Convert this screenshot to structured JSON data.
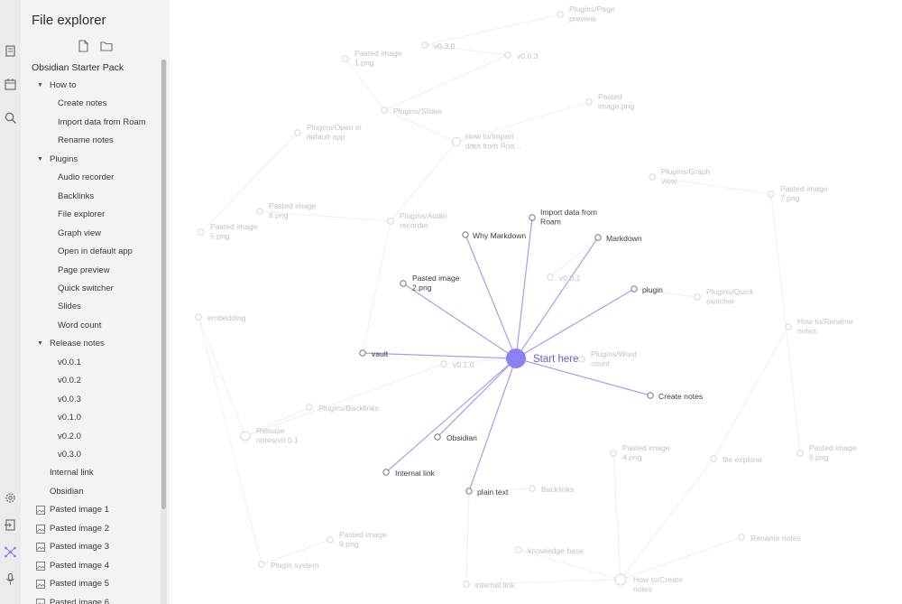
{
  "explorer": {
    "title": "File explorer",
    "vault_name": "Obsidian Starter Pack",
    "tree": [
      {
        "label": "How to",
        "type": "folder"
      },
      {
        "label": "Create notes",
        "type": "file"
      },
      {
        "label": "Import data from Roam",
        "type": "file"
      },
      {
        "label": "Rename notes",
        "type": "file"
      },
      {
        "label": "Plugins",
        "type": "folder"
      },
      {
        "label": "Audio recorder",
        "type": "file"
      },
      {
        "label": "Backlinks",
        "type": "file"
      },
      {
        "label": "File explorer",
        "type": "file"
      },
      {
        "label": "Graph view",
        "type": "file"
      },
      {
        "label": "Open in default app",
        "type": "file"
      },
      {
        "label": "Page preview",
        "type": "file"
      },
      {
        "label": "Quick switcher",
        "type": "file"
      },
      {
        "label": "Slides",
        "type": "file"
      },
      {
        "label": "Word count",
        "type": "file"
      },
      {
        "label": "Release notes",
        "type": "folder"
      },
      {
        "label": "v0.0.1",
        "type": "file"
      },
      {
        "label": "v0.0.2",
        "type": "file"
      },
      {
        "label": "v0.0.3",
        "type": "file"
      },
      {
        "label": "v0.1.0",
        "type": "file"
      },
      {
        "label": "v0.2.0",
        "type": "file"
      },
      {
        "label": "v0.3.0",
        "type": "file"
      },
      {
        "label": "Internal link",
        "type": "root-file"
      },
      {
        "label": "Obsidian",
        "type": "root-file"
      },
      {
        "label": "Pasted image 1",
        "type": "image"
      },
      {
        "label": "Pasted image 2",
        "type": "image"
      },
      {
        "label": "Pasted image 3",
        "type": "image"
      },
      {
        "label": "Pasted image 4",
        "type": "image"
      },
      {
        "label": "Pasted image 5",
        "type": "image"
      },
      {
        "label": "Pasted image 6",
        "type": "image"
      }
    ]
  },
  "ribbon": {
    "icons": [
      "files-icon",
      "calendar-icon",
      "search-icon",
      "settings-icon",
      "import-icon",
      "graph-icon",
      "microphone-icon"
    ]
  },
  "graph": {
    "center": {
      "id": "start",
      "label": "Start here"
    },
    "nodes": [
      {
        "id": "start",
        "label": "Start here"
      },
      {
        "id": "why_markdown",
        "label": "Why Markdown"
      },
      {
        "id": "import_roam",
        "label": "Import data from Roam"
      },
      {
        "id": "markdown",
        "label": "Markdown"
      },
      {
        "id": "plugin",
        "label": "plugin"
      },
      {
        "id": "pasted2",
        "label": "Pasted image 2.png"
      },
      {
        "id": "vault",
        "label": "vault"
      },
      {
        "id": "create_notes",
        "label": "Create notes"
      },
      {
        "id": "obsidian",
        "label": "Obsidian"
      },
      {
        "id": "internal_link_c",
        "label": "Internal link"
      },
      {
        "id": "plain_text",
        "label": "plain text"
      },
      {
        "id": "plugins_page_preview",
        "label": "Plugins/Page preview"
      },
      {
        "id": "v030",
        "label": "v0.3.0"
      },
      {
        "id": "v003",
        "label": "v0.0.3"
      },
      {
        "id": "pasted1",
        "label": "Pasted image 1.png"
      },
      {
        "id": "plugins_slides",
        "label": "Plugins/Slides"
      },
      {
        "id": "pasted_image_png",
        "label": "Pasted image.png"
      },
      {
        "id": "plugins_open",
        "label": "Plugins/Open in default app"
      },
      {
        "id": "howto_import",
        "label": "How to/Import data from Roa..."
      },
      {
        "id": "plugins_graph",
        "label": "Plugins/Graph view"
      },
      {
        "id": "pasted7",
        "label": "Pasted image 7.png"
      },
      {
        "id": "pasted8",
        "label": "Pasted image 8.png"
      },
      {
        "id": "plugins_audio",
        "label": "Plugins/Audio recorder"
      },
      {
        "id": "pasted5",
        "label": "Pasted image 5.png"
      },
      {
        "id": "v001",
        "label": "v0.0.1"
      },
      {
        "id": "plugins_quick",
        "label": "Plugins/Quick switcher"
      },
      {
        "id": "embedding",
        "label": "embedding"
      },
      {
        "id": "howto_rename",
        "label": "How to/Rename notes"
      },
      {
        "id": "v010",
        "label": "v0.1.0"
      },
      {
        "id": "plugins_word",
        "label": "Plugins/Word count"
      },
      {
        "id": "plugins_backlinks",
        "label": "Plugins/Backlinks"
      },
      {
        "id": "release_v001",
        "label": "Release notes/v0.0.1"
      },
      {
        "id": "pasted4",
        "label": "Pasted image 4.png"
      },
      {
        "id": "file_explorer",
        "label": "file explorer"
      },
      {
        "id": "pasted6",
        "label": "Pasted image 6.png"
      },
      {
        "id": "backlinks",
        "label": "Backlinks"
      },
      {
        "id": "pasted9",
        "label": "Pasted image 9.png"
      },
      {
        "id": "rename_notes",
        "label": "Rename notes"
      },
      {
        "id": "plugin_system",
        "label": "Plugin system"
      },
      {
        "id": "knowledge_base",
        "label": "knowledge base"
      },
      {
        "id": "internal_link",
        "label": "internal link"
      },
      {
        "id": "howto_create",
        "label": "How to/Create notes"
      }
    ],
    "highlighted_links": [
      "why_markdown",
      "import_roam",
      "markdown",
      "plugin",
      "pasted2",
      "vault",
      "create_notes",
      "obsidian",
      "internal_link_c",
      "plain_text"
    ],
    "faded_links": [
      [
        "plugins_page_preview",
        "v030"
      ],
      [
        "v030",
        "v003"
      ],
      [
        "v003",
        "plugins_slides"
      ],
      [
        "pasted1",
        "plugins_slides"
      ],
      [
        "plugins_slides",
        "howto_import"
      ],
      [
        "howto_import",
        "pasted_image_png"
      ],
      [
        "howto_import",
        "plugins_audio"
      ],
      [
        "plugins_open",
        "pasted5"
      ],
      [
        "pasted8",
        "plugins_audio"
      ],
      [
        "plugins_audio",
        "vault"
      ],
      [
        "plugins_graph",
        "pasted7"
      ],
      [
        "pasted7",
        "pasted6"
      ],
      [
        "howto_rename",
        "file_explorer"
      ],
      [
        "file_explorer",
        "howto_create"
      ],
      [
        "plugins_quick",
        "plugin"
      ],
      [
        "v001",
        "markdown"
      ],
      [
        "embedding",
        "release_v001"
      ],
      [
        "release_v001",
        "plugins_backlinks"
      ],
      [
        "release_v001",
        "v010"
      ],
      [
        "embedding",
        "plugin_system"
      ],
      [
        "pasted9",
        "plugin_system"
      ],
      [
        "knowledge_base",
        "howto_create"
      ],
      [
        "rename_notes",
        "howto_create"
      ],
      [
        "internal_link",
        "howto_create"
      ],
      [
        "internal_link",
        "plain_text"
      ],
      [
        "pasted4",
        "howto_create"
      ],
      [
        "backlinks",
        "plain_text"
      ],
      [
        "plugins_word",
        "start"
      ],
      [
        "v010",
        "start"
      ]
    ]
  },
  "colors": {
    "accent": "#8b80f4",
    "highlight_link": "#a69ef0",
    "faded_node": "#d6d6d6",
    "faded_text": "#c2c2c2",
    "active_text": "#3c3c3c"
  }
}
